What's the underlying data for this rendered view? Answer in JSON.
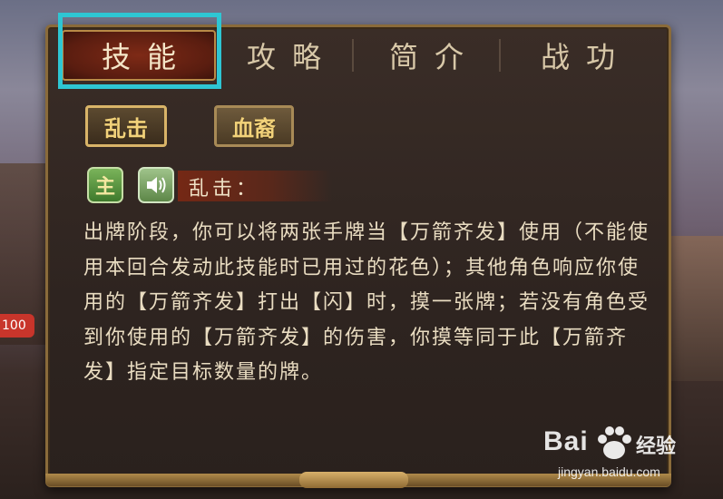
{
  "background": {
    "badge_number": "100"
  },
  "tabs": [
    {
      "label": "技能",
      "active": true
    },
    {
      "label": "攻略",
      "active": false
    },
    {
      "label": "简介",
      "active": false
    },
    {
      "label": "战功",
      "active": false
    }
  ],
  "skill_buttons": [
    {
      "label": "乱击",
      "selected": true
    },
    {
      "label": "血裔",
      "selected": false
    }
  ],
  "skill_detail": {
    "type_tag": "主",
    "sound_icon": "speaker-icon",
    "title": "乱击：",
    "description": "出牌阶段，你可以将两张手牌当【万箭齐发】使用（不能使用本回合发动此技能时已用过的花色）；其他角色响应你使用的【万箭齐发】打出【闪】时，摸一张牌；若没有角色受到你使用的【万箭齐发】的伤害，你摸等同于此【万箭齐发】指定目标数量的牌。"
  },
  "watermark": {
    "logo": "Bai",
    "logo_suffix": "经验",
    "url": "jingyan.baidu.com"
  },
  "colors": {
    "highlight": "#2ec6d3",
    "active_tab": "#7e2a16",
    "gold": "#f2d27a"
  }
}
